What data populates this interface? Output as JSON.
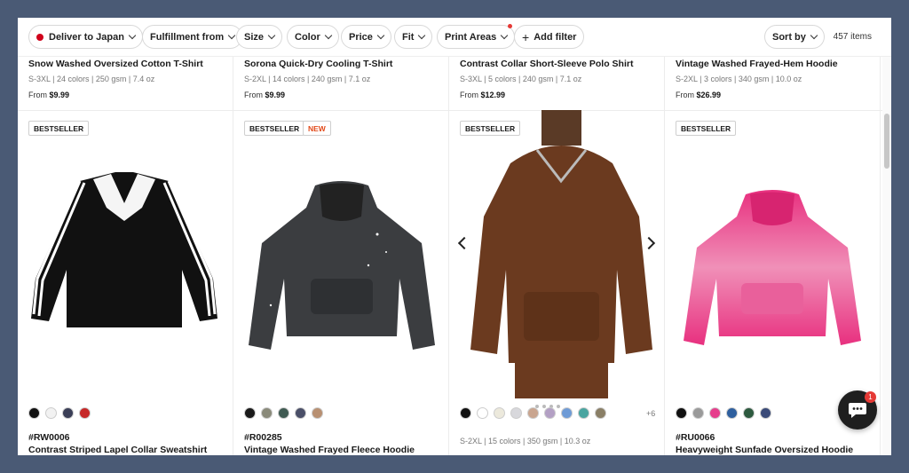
{
  "filters": {
    "deliver": "Deliver to Japan",
    "fulfillment": "Fulfillment from",
    "size": "Size",
    "color": "Color",
    "price": "Price",
    "fit": "Fit",
    "print_areas": "Print Areas",
    "add_filter": "Add filter",
    "sort": "Sort by",
    "count": "457 items"
  },
  "top_products": [
    {
      "title": "Snow Washed Oversized Cotton T-Shirt",
      "specs": "S-3XL | 24 colors | 250 gsm | 7.4 oz",
      "price_prefix": "From",
      "price": "$9.99"
    },
    {
      "title": "Sorona Quick-Dry Cooling T-Shirt",
      "specs": "S-2XL | 14 colors | 240 gsm | 7.1 oz",
      "price_prefix": "From",
      "price": "$9.99"
    },
    {
      "title": "Contrast Collar Short-Sleeve Polo Shirt",
      "specs": "S-3XL | 5 colors | 240 gsm | 7.1 oz",
      "price_prefix": "From",
      "price": "$12.99"
    },
    {
      "title": "Vintage Washed Frayed-Hem Hoodie",
      "specs": "S-2XL | 3 colors | 340 gsm | 10.0 oz",
      "price_prefix": "From",
      "price": "$26.99"
    }
  ],
  "products": [
    {
      "badge": "BESTSELLER",
      "sku": "#RW0006",
      "name": "Contrast Striped Lapel Collar Sweatshirt",
      "swatches": [
        "#111111",
        "#f2f2f2",
        "#3b3f57",
        "#c62828"
      ]
    },
    {
      "badge": "BESTSELLER",
      "badge2": "NEW",
      "sku": "#R00285",
      "name": "Vintage Washed Frayed Fleece Hoodie",
      "swatches": [
        "#1a1a1a",
        "#8a8a7a",
        "#3f5a52",
        "#4a4f68",
        "#b89072"
      ]
    },
    {
      "badge": "BESTSELLER",
      "specs": "S-2XL | 15 colors | 350 gsm | 10.3 oz",
      "more": "+6",
      "swatches": [
        "#111111",
        "#ffffff",
        "#ece9dc",
        "#d8d8dc",
        "#c9a58f",
        "#b3a0c4",
        "#6f9bd6",
        "#4aa5a0",
        "#8a7f66"
      ]
    },
    {
      "badge": "BESTSELLER",
      "sku": "#RU0066",
      "name": "Heavyweight Sunfade Oversized Hoodie",
      "swatches": [
        "#111111",
        "#9a9a9a",
        "#e63e8c",
        "#2e5f9e",
        "#2d5a3f",
        "#3a4a78"
      ]
    }
  ],
  "chat": {
    "badge": "1"
  },
  "icons": [
    "chevron-down-icon",
    "plus-icon",
    "chevron-left-icon",
    "chevron-right-icon",
    "chat-icon"
  ]
}
